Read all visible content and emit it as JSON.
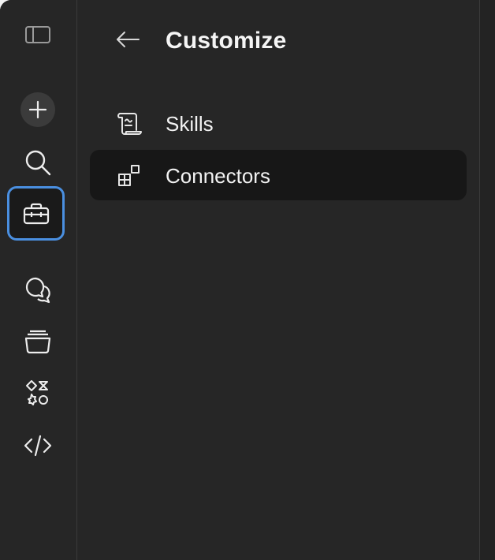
{
  "header": {
    "title": "Customize",
    "back_icon": "arrow-left-icon"
  },
  "rail": {
    "items": [
      {
        "name": "sidebar-toggle",
        "icon": "panel-left-icon"
      },
      {
        "name": "new-chat",
        "icon": "plus-icon"
      },
      {
        "name": "search",
        "icon": "search-icon"
      },
      {
        "name": "customize",
        "icon": "toolbox-icon",
        "active": true
      },
      {
        "name": "chats",
        "icon": "chat-bubbles-icon"
      },
      {
        "name": "projects",
        "icon": "folder-stack-icon"
      },
      {
        "name": "artifacts",
        "icon": "shapes-icon"
      },
      {
        "name": "code",
        "icon": "code-icon"
      }
    ]
  },
  "menu": {
    "items": [
      {
        "label": "Skills",
        "icon": "scroll-icon",
        "selected": false
      },
      {
        "label": "Connectors",
        "icon": "blocks-icon",
        "selected": true
      }
    ]
  },
  "colors": {
    "background": "#262626",
    "selected_row": "#171717",
    "active_outline": "#4a8fe0",
    "text": "#f2f2f2"
  }
}
